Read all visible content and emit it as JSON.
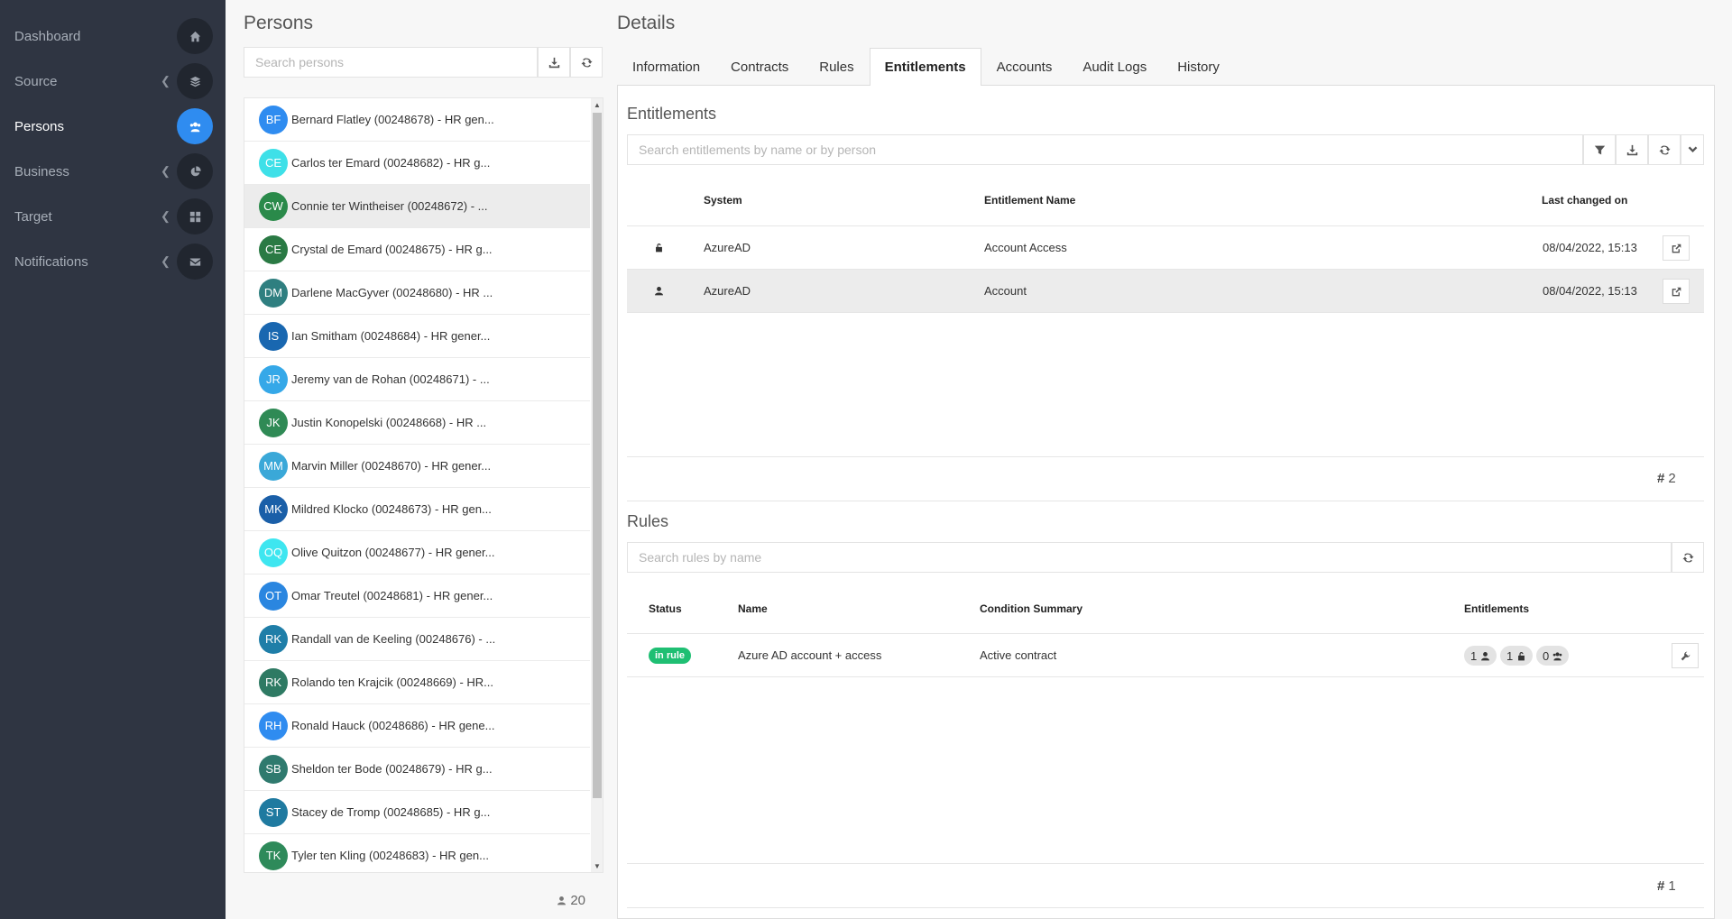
{
  "sidebar": {
    "items": [
      {
        "label": "Dashboard",
        "icon": "home-icon",
        "has_chevron": false,
        "active": false
      },
      {
        "label": "Source",
        "icon": "layers-icon",
        "has_chevron": true,
        "active": false
      },
      {
        "label": "Persons",
        "icon": "users-icon",
        "has_chevron": false,
        "active": true
      },
      {
        "label": "Business",
        "icon": "pie-chart-icon",
        "has_chevron": true,
        "active": false
      },
      {
        "label": "Target",
        "icon": "grid-icon",
        "has_chevron": true,
        "active": false
      },
      {
        "label": "Notifications",
        "icon": "envelope-icon",
        "has_chevron": true,
        "active": false
      }
    ]
  },
  "persons": {
    "title": "Persons",
    "search_placeholder": "Search persons",
    "count": "20",
    "list": [
      {
        "initials": "BF",
        "name": "Bernard Flatley (00248678) - HR gen...",
        "color": "#2f8cf0"
      },
      {
        "initials": "CE",
        "name": "Carlos ter Emard (00248682) - HR g...",
        "color": "#3ee0e8"
      },
      {
        "initials": "CW",
        "name": "Connie ter Wintheiser (00248672) - ...",
        "color": "#2a8a4a"
      },
      {
        "initials": "CE",
        "name": "Crystal de Emard (00248675) - HR g...",
        "color": "#2a7a44"
      },
      {
        "initials": "DM",
        "name": "Darlene MacGyver (00248680) - HR ...",
        "color": "#2f7f80"
      },
      {
        "initials": "IS",
        "name": "Ian Smitham (00248684) - HR gener...",
        "color": "#1967b0"
      },
      {
        "initials": "JR",
        "name": "Jeremy van de Rohan (00248671) - ...",
        "color": "#35a8e8"
      },
      {
        "initials": "JK",
        "name": "Justin Konopelski (00248668) - HR ...",
        "color": "#2f8a55"
      },
      {
        "initials": "MM",
        "name": "Marvin Miller (00248670) - HR gener...",
        "color": "#3aa8d8"
      },
      {
        "initials": "MK",
        "name": "Mildred Klocko (00248673) - HR gen...",
        "color": "#1a5fa8"
      },
      {
        "initials": "OQ",
        "name": "Olive Quitzon (00248677) - HR gener...",
        "color": "#3ee6f0"
      },
      {
        "initials": "OT",
        "name": "Omar Treutel (00248681) - HR gener...",
        "color": "#2a86e0"
      },
      {
        "initials": "RK",
        "name": "Randall van de Keeling (00248676) - ...",
        "color": "#1f7ea8"
      },
      {
        "initials": "RK",
        "name": "Rolando ten Krajcik (00248669) - HR...",
        "color": "#2e7a63"
      },
      {
        "initials": "RH",
        "name": "Ronald Hauck (00248686) - HR gene...",
        "color": "#2f8cf0"
      },
      {
        "initials": "SB",
        "name": "Sheldon ter Bode (00248679) - HR g...",
        "color": "#2f7a6e"
      },
      {
        "initials": "ST",
        "name": "Stacey de Tromp (00248685) - HR g...",
        "color": "#1f7aa0"
      },
      {
        "initials": "TK",
        "name": "Tyler ten Kling (00248683) - HR gen...",
        "color": "#2e8a5a"
      }
    ]
  },
  "details": {
    "title": "Details",
    "tabs": [
      "Information",
      "Contracts",
      "Rules",
      "Entitlements",
      "Accounts",
      "Audit Logs",
      "History"
    ],
    "active_tab": "Entitlements",
    "entitlements": {
      "title": "Entitlements",
      "search_placeholder": "Search entitlements by name or by person",
      "columns": [
        "System",
        "Entitlement Name",
        "Last changed on"
      ],
      "rows": [
        {
          "icon": "unlock-icon",
          "system": "AzureAD",
          "name": "Account Access",
          "changed": "08/04/2022, 15:13"
        },
        {
          "icon": "user-icon",
          "system": "AzureAD",
          "name": "Account",
          "changed": "08/04/2022, 15:13"
        }
      ],
      "count": "2"
    },
    "rules": {
      "title": "Rules",
      "search_placeholder": "Search rules by name",
      "columns": [
        "Status",
        "Name",
        "Condition Summary",
        "Entitlements"
      ],
      "rows": [
        {
          "status": "in rule",
          "name": "Azure AD account + access",
          "condition": "Active contract",
          "counts": [
            "1",
            "1",
            "0"
          ]
        }
      ],
      "count": "1"
    }
  },
  "colors": {
    "sidebar_bg": "#2f3542",
    "accent": "#2f8cf0",
    "success": "#1fbf73"
  }
}
